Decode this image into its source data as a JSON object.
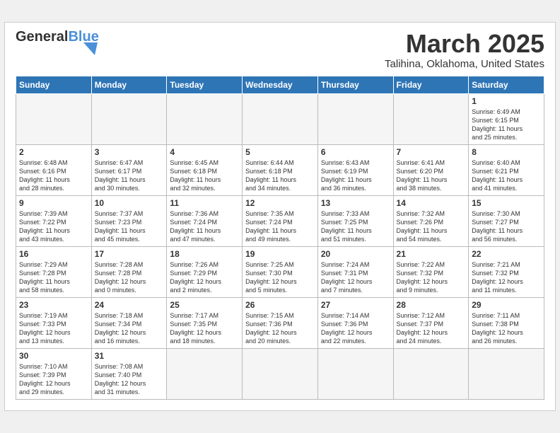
{
  "logo": {
    "text_general": "General",
    "text_blue": "Blue"
  },
  "title": "March 2025",
  "location": "Talihina, Oklahoma, United States",
  "days_of_week": [
    "Sunday",
    "Monday",
    "Tuesday",
    "Wednesday",
    "Thursday",
    "Friday",
    "Saturday"
  ],
  "weeks": [
    [
      {
        "day": "",
        "info": ""
      },
      {
        "day": "",
        "info": ""
      },
      {
        "day": "",
        "info": ""
      },
      {
        "day": "",
        "info": ""
      },
      {
        "day": "",
        "info": ""
      },
      {
        "day": "",
        "info": ""
      },
      {
        "day": "1",
        "info": "Sunrise: 6:49 AM\nSunset: 6:15 PM\nDaylight: 11 hours\nand 25 minutes."
      }
    ],
    [
      {
        "day": "2",
        "info": "Sunrise: 6:48 AM\nSunset: 6:16 PM\nDaylight: 11 hours\nand 28 minutes."
      },
      {
        "day": "3",
        "info": "Sunrise: 6:47 AM\nSunset: 6:17 PM\nDaylight: 11 hours\nand 30 minutes."
      },
      {
        "day": "4",
        "info": "Sunrise: 6:45 AM\nSunset: 6:18 PM\nDaylight: 11 hours\nand 32 minutes."
      },
      {
        "day": "5",
        "info": "Sunrise: 6:44 AM\nSunset: 6:18 PM\nDaylight: 11 hours\nand 34 minutes."
      },
      {
        "day": "6",
        "info": "Sunrise: 6:43 AM\nSunset: 6:19 PM\nDaylight: 11 hours\nand 36 minutes."
      },
      {
        "day": "7",
        "info": "Sunrise: 6:41 AM\nSunset: 6:20 PM\nDaylight: 11 hours\nand 38 minutes."
      },
      {
        "day": "8",
        "info": "Sunrise: 6:40 AM\nSunset: 6:21 PM\nDaylight: 11 hours\nand 41 minutes."
      }
    ],
    [
      {
        "day": "9",
        "info": "Sunrise: 7:39 AM\nSunset: 7:22 PM\nDaylight: 11 hours\nand 43 minutes."
      },
      {
        "day": "10",
        "info": "Sunrise: 7:37 AM\nSunset: 7:23 PM\nDaylight: 11 hours\nand 45 minutes."
      },
      {
        "day": "11",
        "info": "Sunrise: 7:36 AM\nSunset: 7:24 PM\nDaylight: 11 hours\nand 47 minutes."
      },
      {
        "day": "12",
        "info": "Sunrise: 7:35 AM\nSunset: 7:24 PM\nDaylight: 11 hours\nand 49 minutes."
      },
      {
        "day": "13",
        "info": "Sunrise: 7:33 AM\nSunset: 7:25 PM\nDaylight: 11 hours\nand 51 minutes."
      },
      {
        "day": "14",
        "info": "Sunrise: 7:32 AM\nSunset: 7:26 PM\nDaylight: 11 hours\nand 54 minutes."
      },
      {
        "day": "15",
        "info": "Sunrise: 7:30 AM\nSunset: 7:27 PM\nDaylight: 11 hours\nand 56 minutes."
      }
    ],
    [
      {
        "day": "16",
        "info": "Sunrise: 7:29 AM\nSunset: 7:28 PM\nDaylight: 11 hours\nand 58 minutes."
      },
      {
        "day": "17",
        "info": "Sunrise: 7:28 AM\nSunset: 7:28 PM\nDaylight: 12 hours\nand 0 minutes."
      },
      {
        "day": "18",
        "info": "Sunrise: 7:26 AM\nSunset: 7:29 PM\nDaylight: 12 hours\nand 2 minutes."
      },
      {
        "day": "19",
        "info": "Sunrise: 7:25 AM\nSunset: 7:30 PM\nDaylight: 12 hours\nand 5 minutes."
      },
      {
        "day": "20",
        "info": "Sunrise: 7:24 AM\nSunset: 7:31 PM\nDaylight: 12 hours\nand 7 minutes."
      },
      {
        "day": "21",
        "info": "Sunrise: 7:22 AM\nSunset: 7:32 PM\nDaylight: 12 hours\nand 9 minutes."
      },
      {
        "day": "22",
        "info": "Sunrise: 7:21 AM\nSunset: 7:32 PM\nDaylight: 12 hours\nand 11 minutes."
      }
    ],
    [
      {
        "day": "23",
        "info": "Sunrise: 7:19 AM\nSunset: 7:33 PM\nDaylight: 12 hours\nand 13 minutes."
      },
      {
        "day": "24",
        "info": "Sunrise: 7:18 AM\nSunset: 7:34 PM\nDaylight: 12 hours\nand 16 minutes."
      },
      {
        "day": "25",
        "info": "Sunrise: 7:17 AM\nSunset: 7:35 PM\nDaylight: 12 hours\nand 18 minutes."
      },
      {
        "day": "26",
        "info": "Sunrise: 7:15 AM\nSunset: 7:36 PM\nDaylight: 12 hours\nand 20 minutes."
      },
      {
        "day": "27",
        "info": "Sunrise: 7:14 AM\nSunset: 7:36 PM\nDaylight: 12 hours\nand 22 minutes."
      },
      {
        "day": "28",
        "info": "Sunrise: 7:12 AM\nSunset: 7:37 PM\nDaylight: 12 hours\nand 24 minutes."
      },
      {
        "day": "29",
        "info": "Sunrise: 7:11 AM\nSunset: 7:38 PM\nDaylight: 12 hours\nand 26 minutes."
      }
    ],
    [
      {
        "day": "30",
        "info": "Sunrise: 7:10 AM\nSunset: 7:39 PM\nDaylight: 12 hours\nand 29 minutes."
      },
      {
        "day": "31",
        "info": "Sunrise: 7:08 AM\nSunset: 7:40 PM\nDaylight: 12 hours\nand 31 minutes."
      },
      {
        "day": "",
        "info": ""
      },
      {
        "day": "",
        "info": ""
      },
      {
        "day": "",
        "info": ""
      },
      {
        "day": "",
        "info": ""
      },
      {
        "day": "",
        "info": ""
      }
    ]
  ]
}
